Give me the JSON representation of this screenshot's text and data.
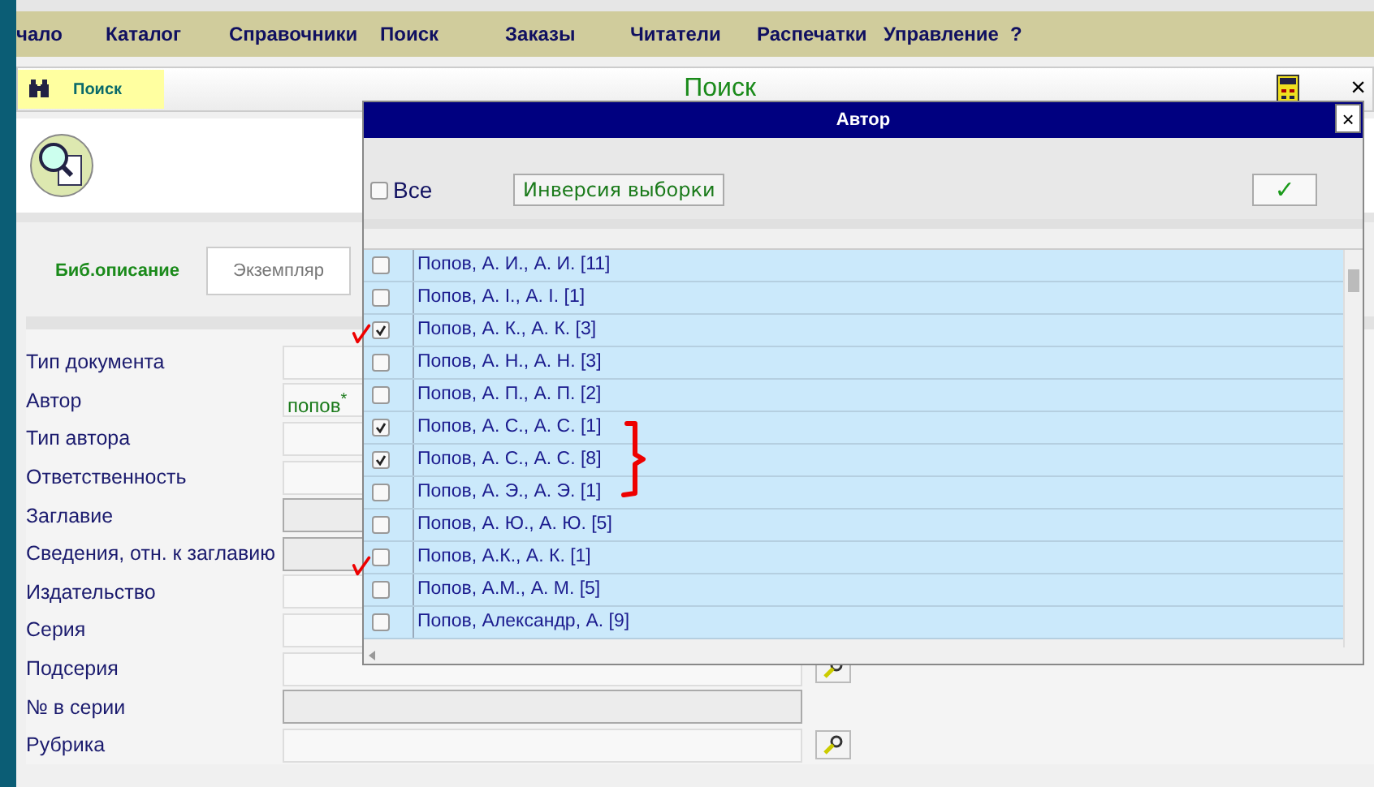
{
  "menu": [
    {
      "label": "чало"
    },
    {
      "label": "Каталог"
    },
    {
      "label": "Справочники"
    },
    {
      "label": "Поиск"
    },
    {
      "label": "Заказы"
    },
    {
      "label": "Читатели"
    },
    {
      "label": "Распечатки"
    },
    {
      "label": "Управление"
    },
    {
      "label": "?"
    }
  ],
  "toolbar": {
    "search_button": "Поиск",
    "title": "Поиск",
    "close": "×"
  },
  "tabs": [
    {
      "label": "Биб.описание",
      "selected": true
    },
    {
      "label": "Экземпляр",
      "selected": false
    }
  ],
  "form": {
    "fields": [
      {
        "label": "Тип документа",
        "locked": false,
        "lookup": false
      },
      {
        "label": "Автор",
        "value": "попов$^{*}$",
        "locked": false,
        "lookup": false
      },
      {
        "label": "Тип автора",
        "locked": false,
        "lookup": false
      },
      {
        "label": "Ответственность",
        "locked": false,
        "lookup": false
      },
      {
        "label": "Заглавие",
        "locked": true,
        "lookup": false
      },
      {
        "label": "Сведения, отн. к заглавию",
        "locked": true,
        "lookup": false
      },
      {
        "label": "Издательство",
        "locked": false,
        "lookup": false
      },
      {
        "label": "Серия",
        "locked": false,
        "lookup": false
      },
      {
        "label": "Подсерия",
        "locked": false,
        "lookup": true
      },
      {
        "label": "№ в серии",
        "locked": true,
        "lookup": false
      },
      {
        "label": "Рубрика",
        "locked": false,
        "lookup": true
      }
    ]
  },
  "dialog": {
    "title": "Автор",
    "close": "×",
    "select_all": {
      "label": "Все",
      "checked": false
    },
    "invert_button": "Инверсия выборки",
    "confirm_button": "✓",
    "items": [
      {
        "label": "Попов, А. И., А. И. [11]",
        "checked": false
      },
      {
        "label": "Попов, А. I., А. I. [1]",
        "checked": false
      },
      {
        "label": "Попов, А. К., А. К. [3]",
        "checked": true
      },
      {
        "label": "Попов, А. Н., А. Н. [3]",
        "checked": false
      },
      {
        "label": "Попов, А. П., А. П. [2]",
        "checked": false
      },
      {
        "label": "Попов, А. С., А. С. [1]",
        "checked": true
      },
      {
        "label": "Попов, А. С., А. С. [8]",
        "checked": true
      },
      {
        "label": "Попов, А. Э., А. Э. [1]",
        "checked": false
      },
      {
        "label": "Попов, А. Ю., А. Ю. [5]",
        "checked": false
      },
      {
        "label": "Попов, А.К., А. К. [1]",
        "checked": false
      },
      {
        "label": "Попов, А.М., А. М. [5]",
        "checked": false
      },
      {
        "label": "Попов, Александр, А. [9]",
        "checked": false
      }
    ]
  }
}
